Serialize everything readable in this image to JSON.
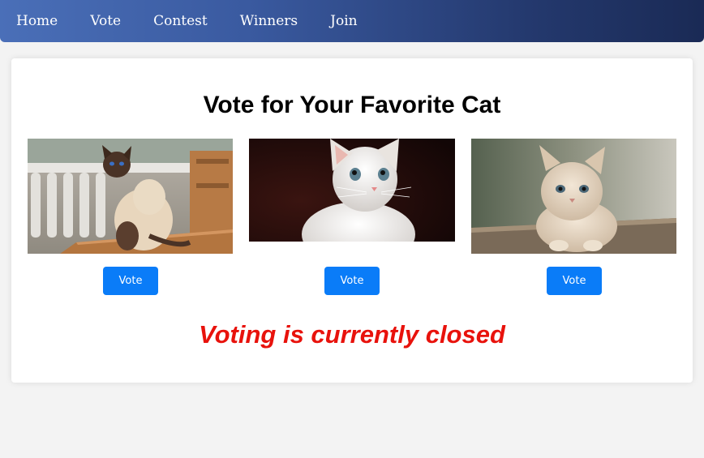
{
  "nav": {
    "items": [
      {
        "label": "Home"
      },
      {
        "label": "Vote"
      },
      {
        "label": "Contest"
      },
      {
        "label": "Winners"
      },
      {
        "label": "Join"
      }
    ]
  },
  "main": {
    "title": "Vote for Your Favorite Cat",
    "cats": [
      {
        "image": "siamese-cat-photo",
        "vote_label": "Vote"
      },
      {
        "image": "white-kitten-photo",
        "vote_label": "Vote"
      },
      {
        "image": "fluffy-kitten-photo",
        "vote_label": "Vote"
      }
    ],
    "status": "Voting is currently closed"
  },
  "colors": {
    "vote_button": "#0a7cf8",
    "closed_text": "#e8120c",
    "nav_start": "#4a6fb8",
    "nav_end": "#1a2a55"
  }
}
